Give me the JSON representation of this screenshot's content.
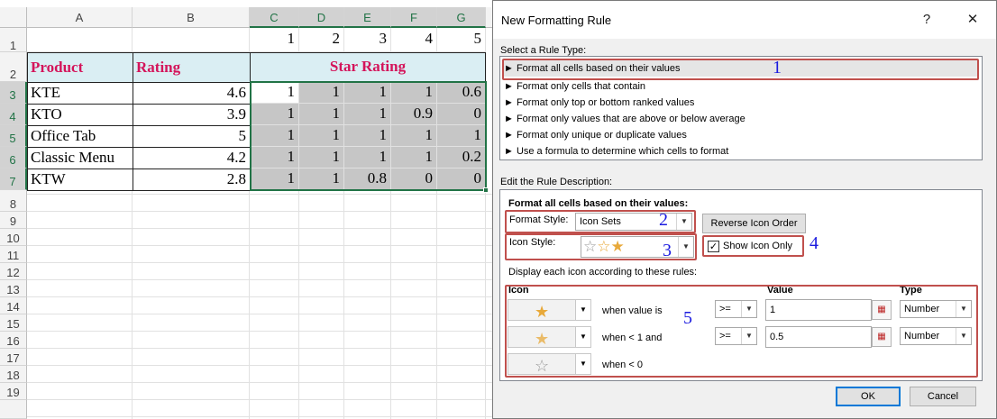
{
  "sheet": {
    "columns": [
      "A",
      "B",
      "C",
      "D",
      "E",
      "F",
      "G"
    ],
    "rows": [
      "1",
      "2",
      "3",
      "4",
      "5",
      "6",
      "7",
      "8",
      "9",
      "10",
      "11",
      "12",
      "13",
      "14",
      "15",
      "16",
      "17",
      "18",
      "19"
    ],
    "row1_values": [
      "1",
      "2",
      "3",
      "4",
      "5"
    ],
    "headers": {
      "product": "Product",
      "rating": "Rating",
      "star_rating": "Star Rating"
    },
    "data": [
      {
        "product": "KTE",
        "rating": "4.6",
        "stars": [
          "1",
          "1",
          "1",
          "1",
          "0.6"
        ]
      },
      {
        "product": "KTO",
        "rating": "3.9",
        "stars": [
          "1",
          "1",
          "1",
          "0.9",
          "0"
        ]
      },
      {
        "product": "Office Tab",
        "rating": "5",
        "stars": [
          "1",
          "1",
          "1",
          "1",
          "1"
        ]
      },
      {
        "product": "Classic Menu",
        "rating": "4.2",
        "stars": [
          "1",
          "1",
          "1",
          "1",
          "0.2"
        ]
      },
      {
        "product": "KTW",
        "rating": "2.8",
        "stars": [
          "1",
          "1",
          "0.8",
          "0",
          "0"
        ]
      }
    ]
  },
  "dialog": {
    "title": "New Formatting Rule",
    "help_label": "?",
    "close_label": "✕",
    "select_rule_type_label": "Select a Rule Type:",
    "rule_types": [
      "► Format all cells based on their values",
      "► Format only cells that contain",
      "► Format only top or bottom ranked values",
      "► Format only values that are above or below average",
      "► Format only unique or duplicate values",
      "► Use a formula to determine which cells to format"
    ],
    "edit_rule_label": "Edit the Rule Description:",
    "format_all_label": "Format all cells based on their values:",
    "format_style_label": "Format Style:",
    "format_style_value": "Icon Sets",
    "reverse_icon_order_label": "Reverse Icon Order",
    "icon_style_label": "Icon Style:",
    "show_icon_only_label": "Show Icon Only",
    "show_icon_only_checked": true,
    "display_rules_label": "Display each icon according to these rules:",
    "columns": {
      "icon": "Icon",
      "value": "Value",
      "type": "Type"
    },
    "icon_rules": [
      {
        "icon": "full-star-icon",
        "glyph": "★",
        "text": "when value is",
        "operator": ">=",
        "value": "1",
        "type": "Number"
      },
      {
        "icon": "half-star-icon",
        "glyph": "★",
        "text": "when < 1 and",
        "operator": ">=",
        "value": "0.5",
        "type": "Number"
      },
      {
        "icon": "empty-star-icon",
        "glyph": "☆",
        "text": "when < 0"
      }
    ],
    "ok_label": "OK",
    "cancel_label": "Cancel"
  },
  "annotations": [
    "1",
    "2",
    "3",
    "4",
    "5"
  ],
  "colors": {
    "header_text": "#d4145a",
    "header_fill": "#daeef3",
    "highlight": "#c0504d",
    "annotation": "#1a1adf",
    "star": "#e8a93a"
  }
}
